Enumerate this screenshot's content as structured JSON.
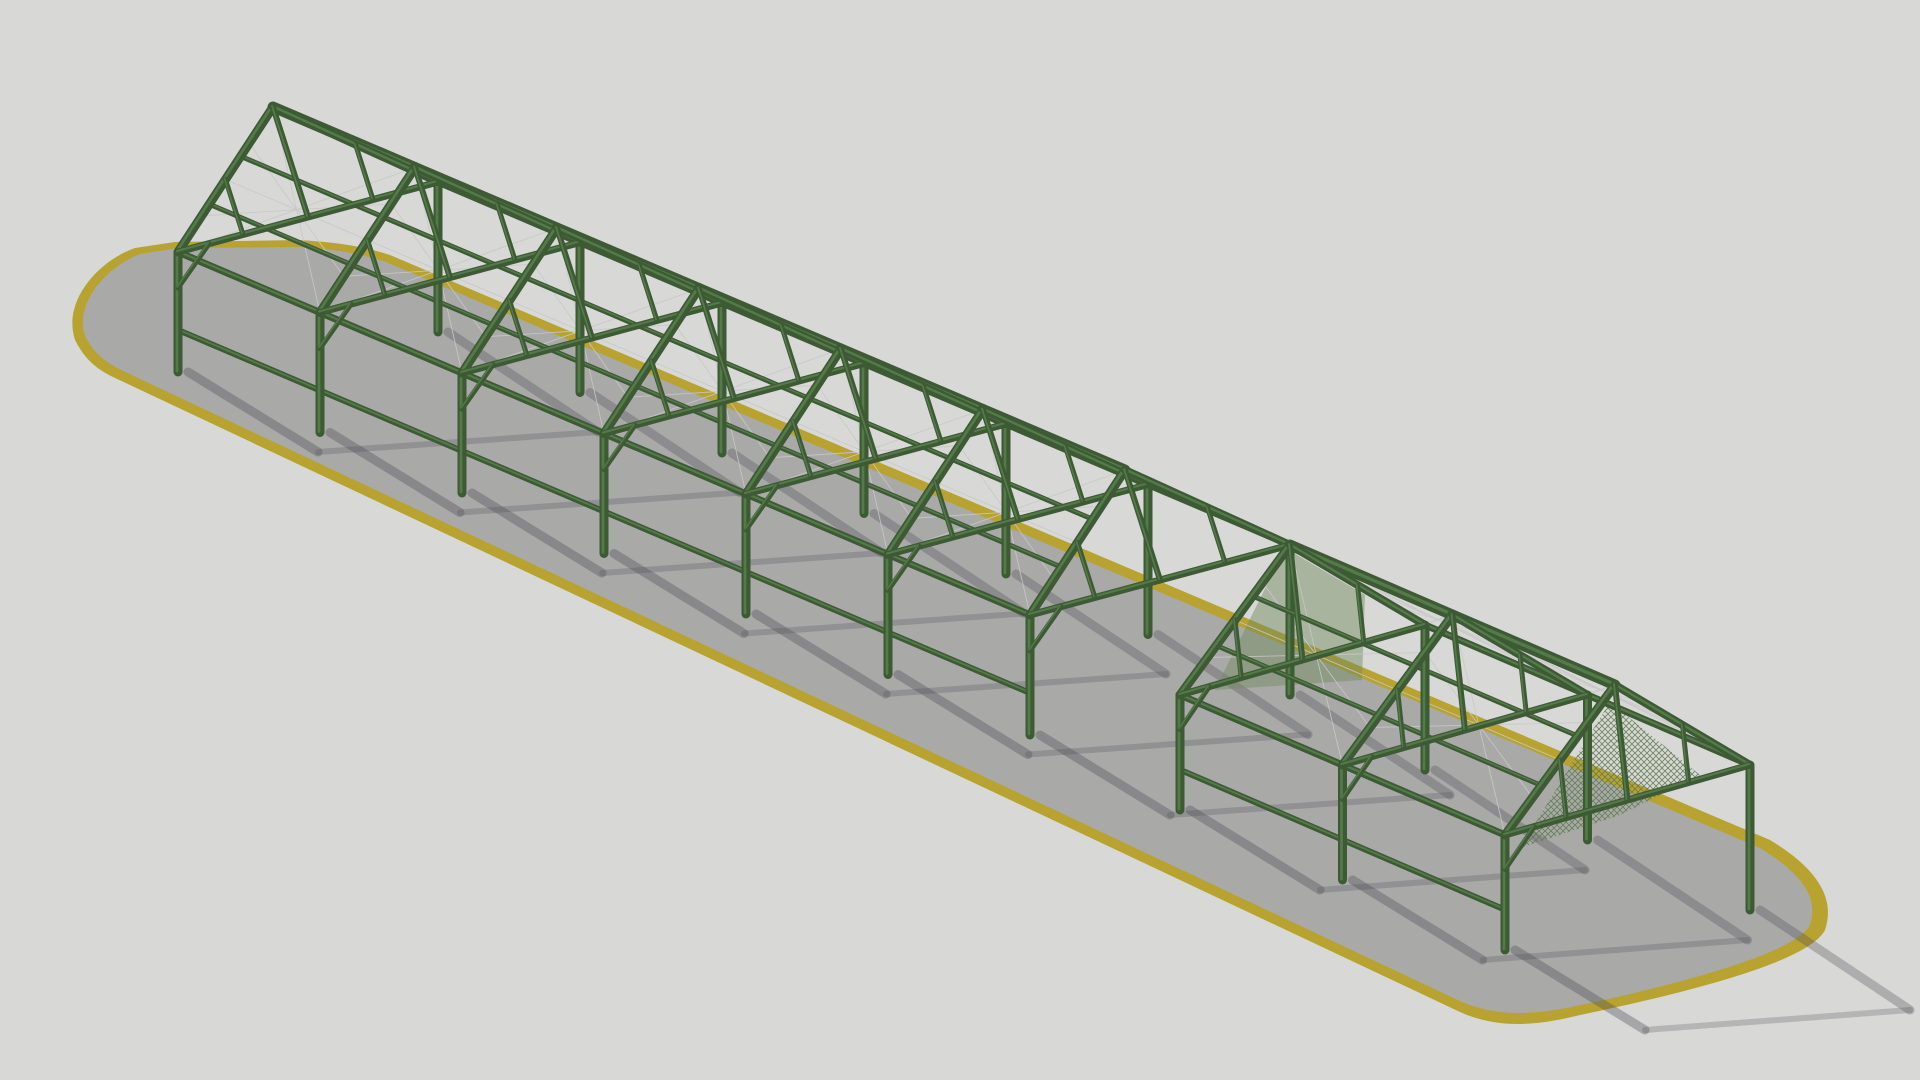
{
  "scene": {
    "view": "isometric",
    "background_color": "#d9d9d7",
    "pad_color": "#a9a9a8",
    "pad_edge_color": "#b8a230",
    "steel_color": "#3d5a35",
    "steel_highlight_color": "#557a4a",
    "cable_color": "#c8c8c8",
    "mesh_color": "#6f8a5c",
    "shadow_color": "#4a4a52"
  },
  "structures": [
    {
      "name": "long-canopy-frame",
      "bays": 6
    },
    {
      "name": "short-canopy-frame",
      "bays": 2
    }
  ]
}
